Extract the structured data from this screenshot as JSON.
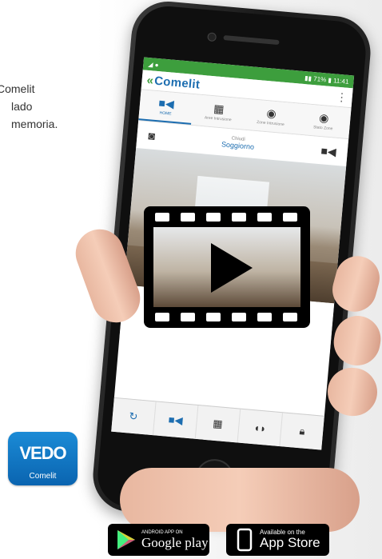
{
  "side_text": [
    "Comelit",
    "lado",
    "memoria."
  ],
  "app": {
    "status_time": "11:41",
    "status_battery": "71%",
    "brand": "Comelit",
    "tabs": [
      {
        "label": "HOME",
        "icon": "camera-icon",
        "active": true
      },
      {
        "label": "Aree Intrusione",
        "icon": "grid-icon",
        "active": false
      },
      {
        "label": "Zone Intrusione",
        "icon": "target-icon",
        "active": false
      },
      {
        "label": "Stato Zone",
        "icon": "target-icon",
        "active": false
      }
    ],
    "camera_status": "Chiudi",
    "camera_name": "Soggiorno",
    "toolbar_icons": [
      "refresh-icon",
      "camera-icon",
      "grid-icon",
      "intercom-icon",
      "lock-icon"
    ]
  },
  "logo": {
    "top": "VEDO",
    "bottom": "Comelit"
  },
  "stores": {
    "google": {
      "small": "ANDROID APP ON",
      "big": "Google play"
    },
    "apple": {
      "small": "Available on the",
      "big": "App Store"
    }
  }
}
